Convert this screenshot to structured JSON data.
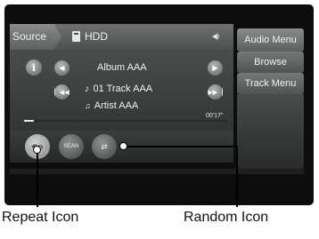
{
  "header": {
    "source_label": "Source",
    "source_value": "HDD",
    "volume_icon": "speaker-volume-icon"
  },
  "menu": {
    "items": [
      "Audio Menu",
      "Browse",
      "Track Menu"
    ]
  },
  "now_playing": {
    "album": "Album AAA",
    "track": "01 Track AAA",
    "artist": "Artist AAA",
    "elapsed": "00'17\"",
    "progress_fraction": 0.05
  },
  "controls": {
    "scan_label": "SCAN",
    "info_label": "i"
  },
  "callouts": {
    "repeat": "Repeat Icon",
    "random": "Random Icon"
  }
}
